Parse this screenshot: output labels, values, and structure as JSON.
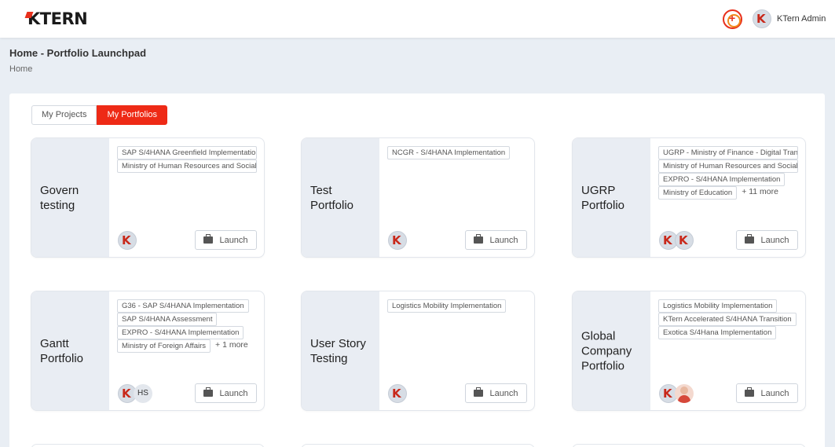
{
  "header": {
    "logo": "KTERN",
    "user_name": "KTern Admin"
  },
  "page": {
    "title": "Home - Portfolio Launchpad",
    "breadcrumb": "Home"
  },
  "tabs": [
    {
      "label": "My Projects",
      "active": false
    },
    {
      "label": "My Portfolios",
      "active": true
    }
  ],
  "accent_color": "#ee2a16",
  "cards": [
    {
      "title": "Govern testing",
      "tags": [
        "SAP S/4HANA Greenfield Implementation",
        "Ministry of Human Resources and Social Development"
      ],
      "more": "",
      "avatars": [
        "ktern"
      ],
      "launch": "Launch"
    },
    {
      "title": "Test Portfolio",
      "tags": [
        "NCGR - S/4HANA Implementation"
      ],
      "more": "",
      "avatars": [
        "ktern"
      ],
      "launch": "Launch"
    },
    {
      "title": "UGRP Portfolio",
      "tags": [
        "UGRP - Ministry of Finance - Digital Transformation",
        "Ministry of Human Resources and Social Development",
        "EXPRO - S/4HANA Implementation",
        "Ministry of Education"
      ],
      "more": "+ 11 more",
      "avatars": [
        "ktern",
        "ktern"
      ],
      "launch": "Launch"
    },
    {
      "title": "Gantt Portfolio",
      "tags": [
        "G36 - SAP S/4HANA Implementation",
        "SAP S/4HANA Assessment",
        "EXPRO - S/4HANA Implementation",
        "Ministry of Foreign Affairs"
      ],
      "more": "+ 1 more",
      "avatars": [
        "ktern",
        "HS"
      ],
      "launch": "Launch"
    },
    {
      "title": "User Story Testing",
      "tags": [
        "Logistics Mobility Implementation"
      ],
      "more": "",
      "avatars": [
        "ktern"
      ],
      "launch": "Launch"
    },
    {
      "title": "Global Company Portfolio",
      "tags": [
        "Logistics Mobility Implementation",
        "KTern Accelerated S/4HANA Transition",
        "Exotica S/4Hana Implementation"
      ],
      "more": "",
      "avatars": [
        "ktern",
        "photo"
      ],
      "launch": "Launch"
    }
  ]
}
